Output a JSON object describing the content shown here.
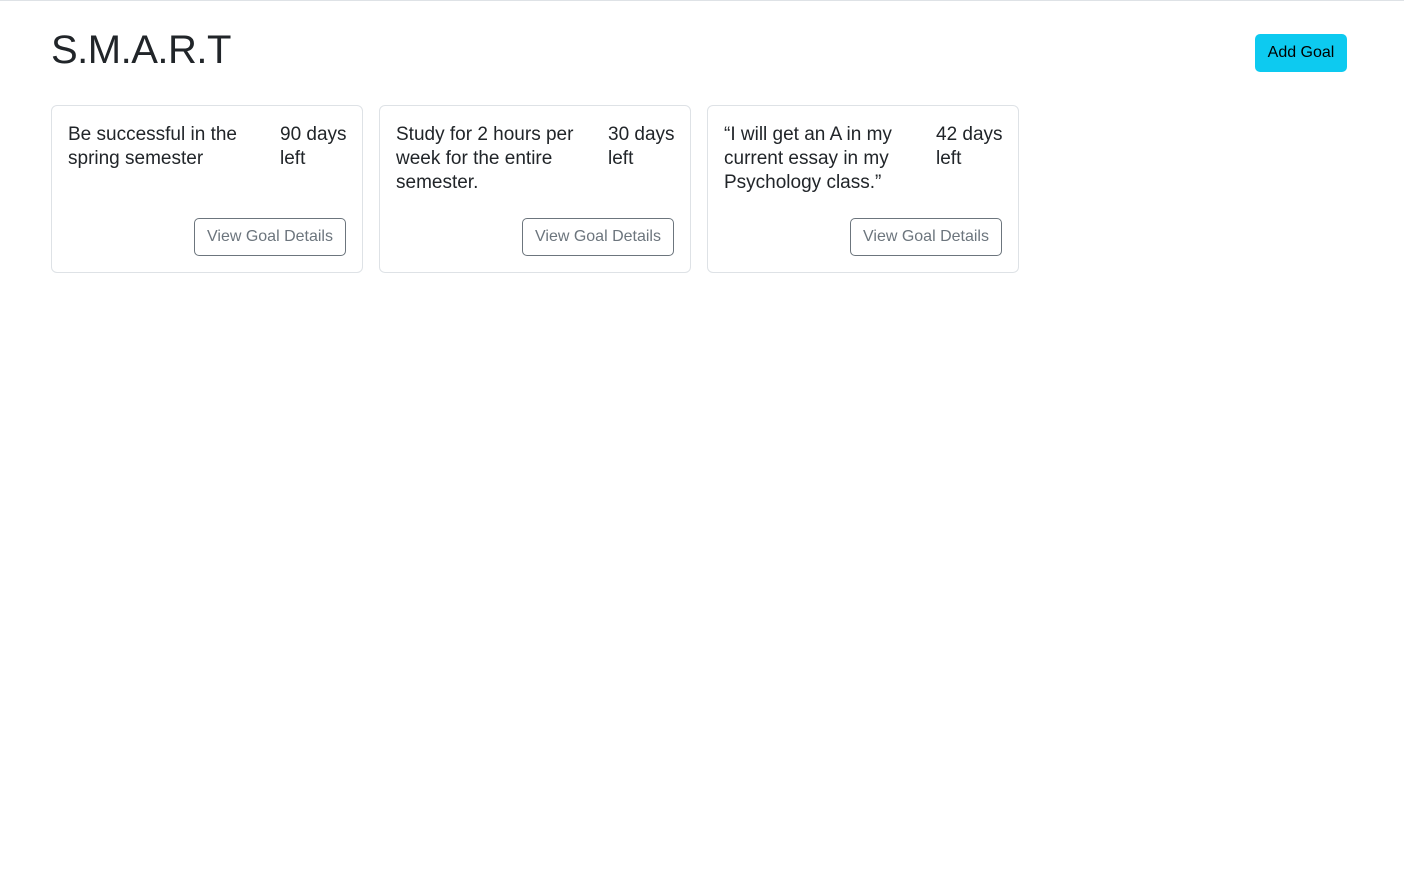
{
  "app": {
    "title": "S.M.A.R.T"
  },
  "header": {
    "add_goal_label": "Add Goal"
  },
  "goals": [
    {
      "text": "Be successful in the spring semester",
      "days_left": "90 days left",
      "button_label": "View Goal Details"
    },
    {
      "text": "Study for 2 hours per week for the entire semester.",
      "days_left": "30 days left",
      "button_label": "View Goal Details"
    },
    {
      "text": "“I will get an A in my current essay in my Psychology class.”",
      "days_left": "42 days left",
      "button_label": "View Goal Details"
    }
  ],
  "colors": {
    "accent": "#0dcaf0",
    "border": "#dee2e6",
    "secondary": "#6c757d",
    "text": "#212529"
  }
}
